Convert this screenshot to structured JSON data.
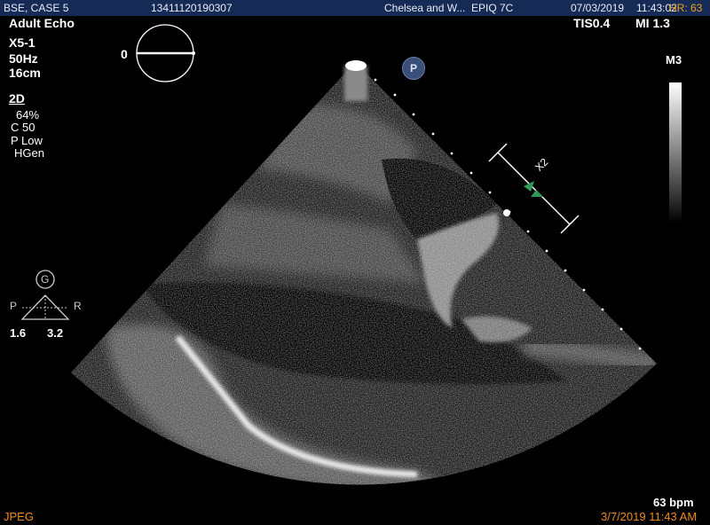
{
  "topbar": {
    "patient": "BSE, CASE 5",
    "id": "13411120190307",
    "institution": "Chelsea and W...",
    "system": "EPIQ 7C",
    "date": "07/03/2019",
    "time": "11:43:02",
    "hr": "HR: 63"
  },
  "left_panel": {
    "preset": "Adult Echo",
    "probe": "X5-1",
    "frame_rate": "50Hz",
    "depth": "16cm",
    "mode": "2D",
    "gain": "64%",
    "compress": "C 50",
    "power": "P Low",
    "gen": "HGen",
    "plane_angle": "0"
  },
  "right_panel": {
    "tis": "TIS0.4",
    "mi": "MI 1.3",
    "map": "M3",
    "bpm": "63 bpm",
    "timestamp": "3/7/2019 11:43 AM"
  },
  "orientation": {
    "g_label": "G",
    "p_label": "P",
    "r_label": "R",
    "left_value": "1.6",
    "right_value": "3.2"
  },
  "annotations": {
    "x2_label": "X2",
    "p_badge": "P"
  },
  "footer": {
    "format": "JPEG"
  }
}
